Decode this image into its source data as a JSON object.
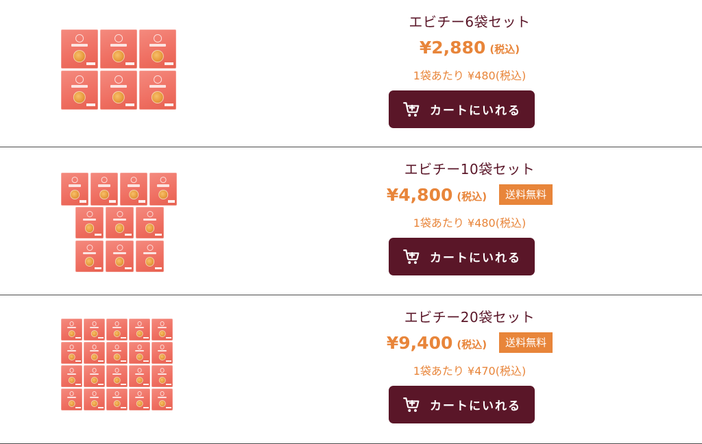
{
  "products": [
    {
      "title": "エビチー6袋セット",
      "price": "¥2,880",
      "tax": "(税込)",
      "per_bag": "1袋あたり ¥480(税込)",
      "cart_label": "カートにいれる",
      "image_alt": "エビチー 6袋",
      "bag_count": 6
    },
    {
      "title": "エビチー10袋セット",
      "price": "¥4,800",
      "tax": "(税込)",
      "badge": "送料無料",
      "per_bag": "1袋あたり ¥480(税込)",
      "cart_label": "カートにいれる",
      "image_alt": "エビチー 10袋",
      "bag_count": 10
    },
    {
      "title": "エビチー20袋セット",
      "price": "¥9,400",
      "tax": "(税込)",
      "badge": "送料無料",
      "per_bag": "1袋あたり ¥470(税込)",
      "cart_label": "カートにいれる",
      "image_alt": "エビチー 20袋",
      "bag_count": 20
    }
  ],
  "colors": {
    "accent": "#e8853a",
    "brand": "#5a1628",
    "bag": "#ef6f62",
    "divider": "#4a4a4a"
  },
  "icons": {
    "cart": "cart-plus-icon",
    "bag": "snack-bag-icon"
  }
}
